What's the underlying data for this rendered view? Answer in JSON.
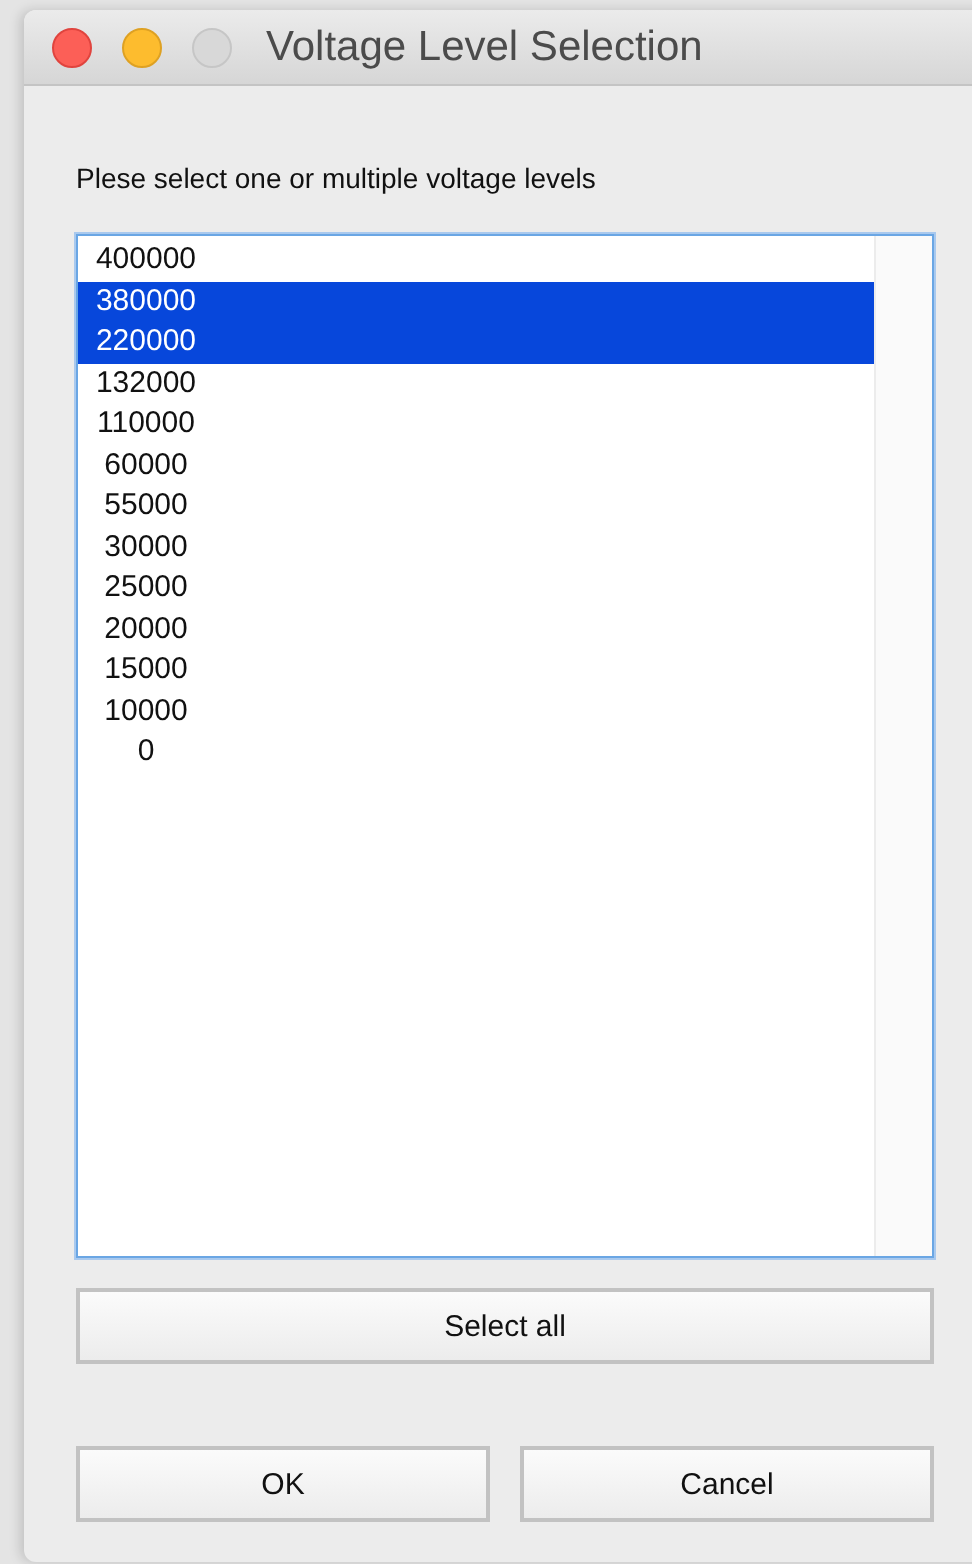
{
  "window": {
    "title": "Voltage Level Selection"
  },
  "prompt": "Plese select one or multiple voltage levels",
  "levels": [
    {
      "label": "400000",
      "selected": false
    },
    {
      "label": "380000",
      "selected": true
    },
    {
      "label": "220000",
      "selected": true
    },
    {
      "label": "132000",
      "selected": false
    },
    {
      "label": "110000",
      "selected": false
    },
    {
      "label": "60000",
      "selected": false
    },
    {
      "label": "55000",
      "selected": false
    },
    {
      "label": "30000",
      "selected": false
    },
    {
      "label": "25000",
      "selected": false
    },
    {
      "label": "20000",
      "selected": false
    },
    {
      "label": "15000",
      "selected": false
    },
    {
      "label": "10000",
      "selected": false
    },
    {
      "label": "0",
      "selected": false
    }
  ],
  "select_all_button": "Select all",
  "buttons": [
    "OK",
    "Cancel"
  ]
}
